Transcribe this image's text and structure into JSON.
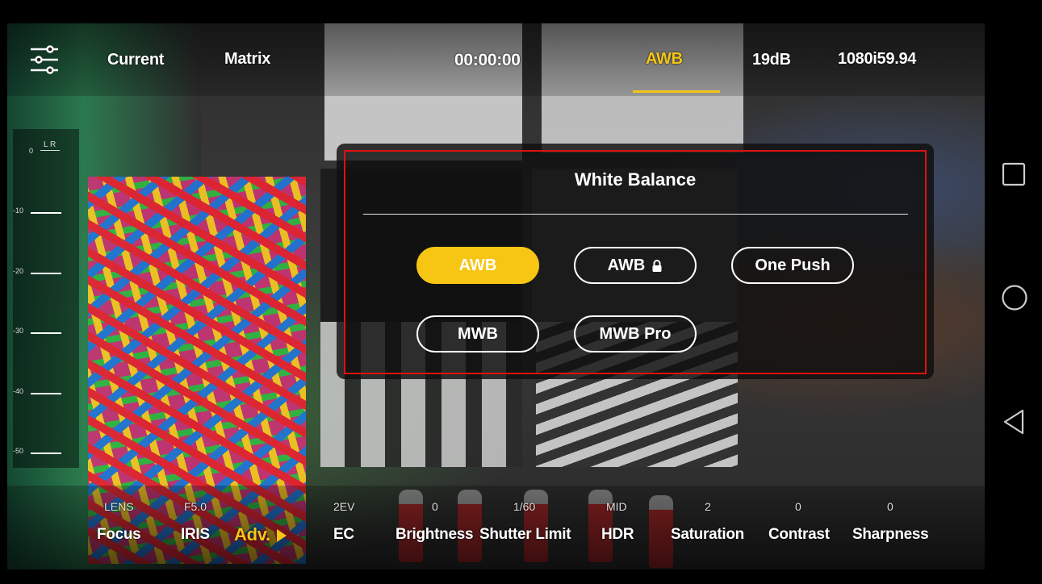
{
  "top_bar": {
    "settings_icon": "sliders-icon",
    "current_label": "Current",
    "matrix_label": "Matrix",
    "timecode": "00:00:00",
    "white_balance": "AWB",
    "gain": "19dB",
    "format": "1080i59.94"
  },
  "audio_meter": {
    "channels": "L  R",
    "ticks": [
      "0",
      "-10",
      "-20",
      "-30",
      "-40",
      "-50"
    ]
  },
  "white_balance_panel": {
    "title": "White Balance",
    "buttons": [
      {
        "label": "AWB",
        "selected": true
      },
      {
        "label": "AWB",
        "icon": "lock-icon",
        "selected": false
      },
      {
        "label": "One Push",
        "selected": false
      },
      {
        "label": "MWB",
        "selected": false
      },
      {
        "label": "MWB Pro",
        "selected": false
      }
    ],
    "accent_color": "#f7c614",
    "highlight_color": "#e01010"
  },
  "bottom_bar": {
    "params": [
      {
        "value": "LENS",
        "label": "Focus"
      },
      {
        "value": "F5.0",
        "label": "IRIS"
      },
      {
        "value": "",
        "label": "Adv."
      },
      {
        "value": "2EV",
        "label": "EC"
      },
      {
        "value": "0",
        "label": "Brightness"
      },
      {
        "value": "1/60",
        "label": "Shutter Limit"
      },
      {
        "value": "MID",
        "label": "HDR"
      },
      {
        "value": "2",
        "label": "Saturation"
      },
      {
        "value": "0",
        "label": "Contrast"
      },
      {
        "value": "0",
        "label": "Sharpness"
      }
    ]
  },
  "nav": {
    "recents": "square-icon",
    "home": "circle-icon",
    "back": "triangle-back-icon"
  }
}
